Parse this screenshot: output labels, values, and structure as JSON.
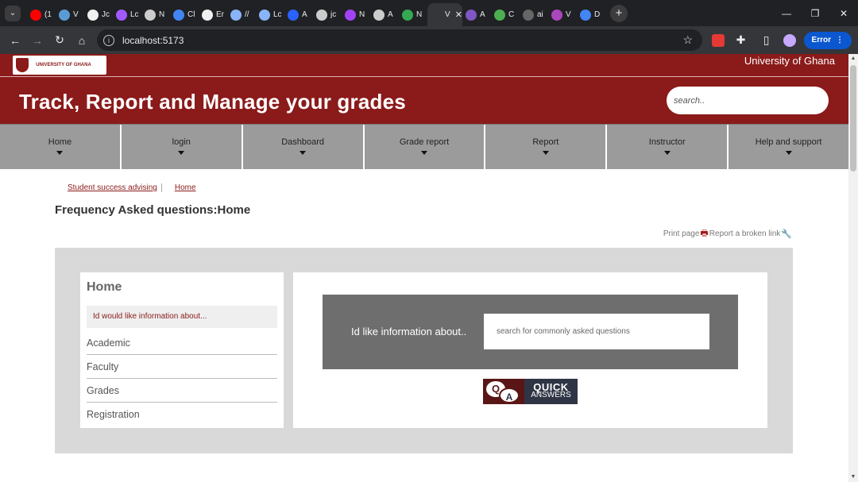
{
  "browser": {
    "tabs": [
      {
        "label": "(1",
        "color": "#ff0000"
      },
      {
        "label": "V",
        "color": "#5b9bd5"
      },
      {
        "label": "Jc",
        "color": "#f0f0f0"
      },
      {
        "label": "Lc",
        "color": "#a259ff"
      },
      {
        "label": "N",
        "color": "#cccccc"
      },
      {
        "label": "Cl",
        "color": "#4285f4"
      },
      {
        "label": "Er",
        "color": "#f0f0f0"
      },
      {
        "label": "//",
        "color": "#8ab4f8"
      },
      {
        "label": "Lc",
        "color": "#8ab4f8"
      },
      {
        "label": "A",
        "color": "#2962ff"
      },
      {
        "label": "jc",
        "color": "#cccccc"
      },
      {
        "label": "N",
        "color": "#a142f4"
      },
      {
        "label": "A",
        "color": "#cccccc"
      },
      {
        "label": "N",
        "color": "#34a853"
      },
      {
        "label": "V",
        "color": "#35363a",
        "active": true
      },
      {
        "label": "A",
        "color": "#7e57c2"
      },
      {
        "label": "C",
        "color": "#4caf50"
      },
      {
        "label": "ai",
        "color": "#666666"
      },
      {
        "label": "V",
        "color": "#ab47bc"
      },
      {
        "label": "D",
        "color": "#4285f4"
      }
    ],
    "active_tab_close": "✕",
    "new_tab": "+",
    "url": "localhost:5173",
    "error_label": "Error"
  },
  "site": {
    "logo_text": "UNIVERSITY OF GHANA",
    "university": "University of Ghana",
    "headline": "Track, Report and Manage your grades",
    "search_placeholder": "search.."
  },
  "nav": [
    {
      "label": "Home"
    },
    {
      "label": "login"
    },
    {
      "label": "Dashboard"
    },
    {
      "label": "Grade report"
    },
    {
      "label": "Report"
    },
    {
      "label": "Instructor"
    },
    {
      "label": "Help and support"
    }
  ],
  "breadcrumb": {
    "first": "Student success advising",
    "second": "Home"
  },
  "page_title": "Frequency Asked questions:Home",
  "tools": {
    "print": "Print page",
    "broken": "Report a broken link"
  },
  "sidebar": {
    "title": "Home",
    "hint": "Id would like information about...",
    "topics": [
      "Academic",
      "Faculty",
      "Grades",
      "Registration"
    ]
  },
  "faq": {
    "label": "Id like information about..",
    "placeholder": "search for commonly asked questions",
    "quick_line1": "QUICK",
    "quick_line2": "ANSWERS"
  },
  "colors": {
    "brand": "#8b1a1a",
    "nav": "#9b9b9b",
    "panel": "#d9d9da"
  }
}
